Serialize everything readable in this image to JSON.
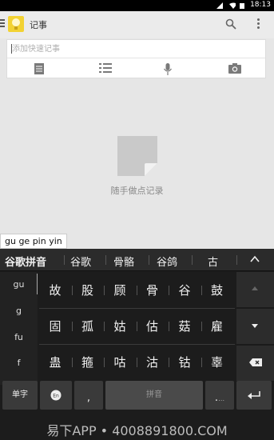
{
  "status_bar": {
    "time": "18:13",
    "icons": [
      "signal-icon",
      "wifi-icon",
      "battery-icon"
    ]
  },
  "app_bar": {
    "title": "记事",
    "logo_color": "#f2d233",
    "icons": [
      "menu-icon",
      "search-icon",
      "more-icon"
    ]
  },
  "quick_note": {
    "placeholder": "添加快速记事",
    "value": "",
    "tools": [
      "text-note-icon",
      "list-icon",
      "microphone-icon",
      "camera-icon"
    ]
  },
  "empty_state": {
    "text": "随手做点记录"
  },
  "ime": {
    "composing": "gu ge pin yin",
    "candidates": [
      "谷歌拼音",
      "谷歌",
      "骨骼",
      "谷鸽",
      "古"
    ],
    "pinyin_options": [
      "gu",
      "g",
      "fu",
      "f"
    ],
    "grid": [
      [
        "故",
        "股",
        "顾",
        "骨",
        "谷",
        "鼓"
      ],
      [
        "固",
        "孤",
        "姑",
        "估",
        "菇",
        "雇"
      ],
      [
        "蛊",
        "箍",
        "咕",
        "沽",
        "钴",
        "辜"
      ]
    ],
    "bottom_row": {
      "mode_label": "单字",
      "lang_label": "En",
      "comma": ",",
      "space_label": "拼音",
      "period": ".",
      "period_hint": "…"
    }
  },
  "watermark": {
    "text": "易下APP • 4008891800.COM"
  },
  "colors": {
    "background": "#e6e6e6",
    "keyboard": "#1c1c1c",
    "logo": "#f2d233"
  }
}
